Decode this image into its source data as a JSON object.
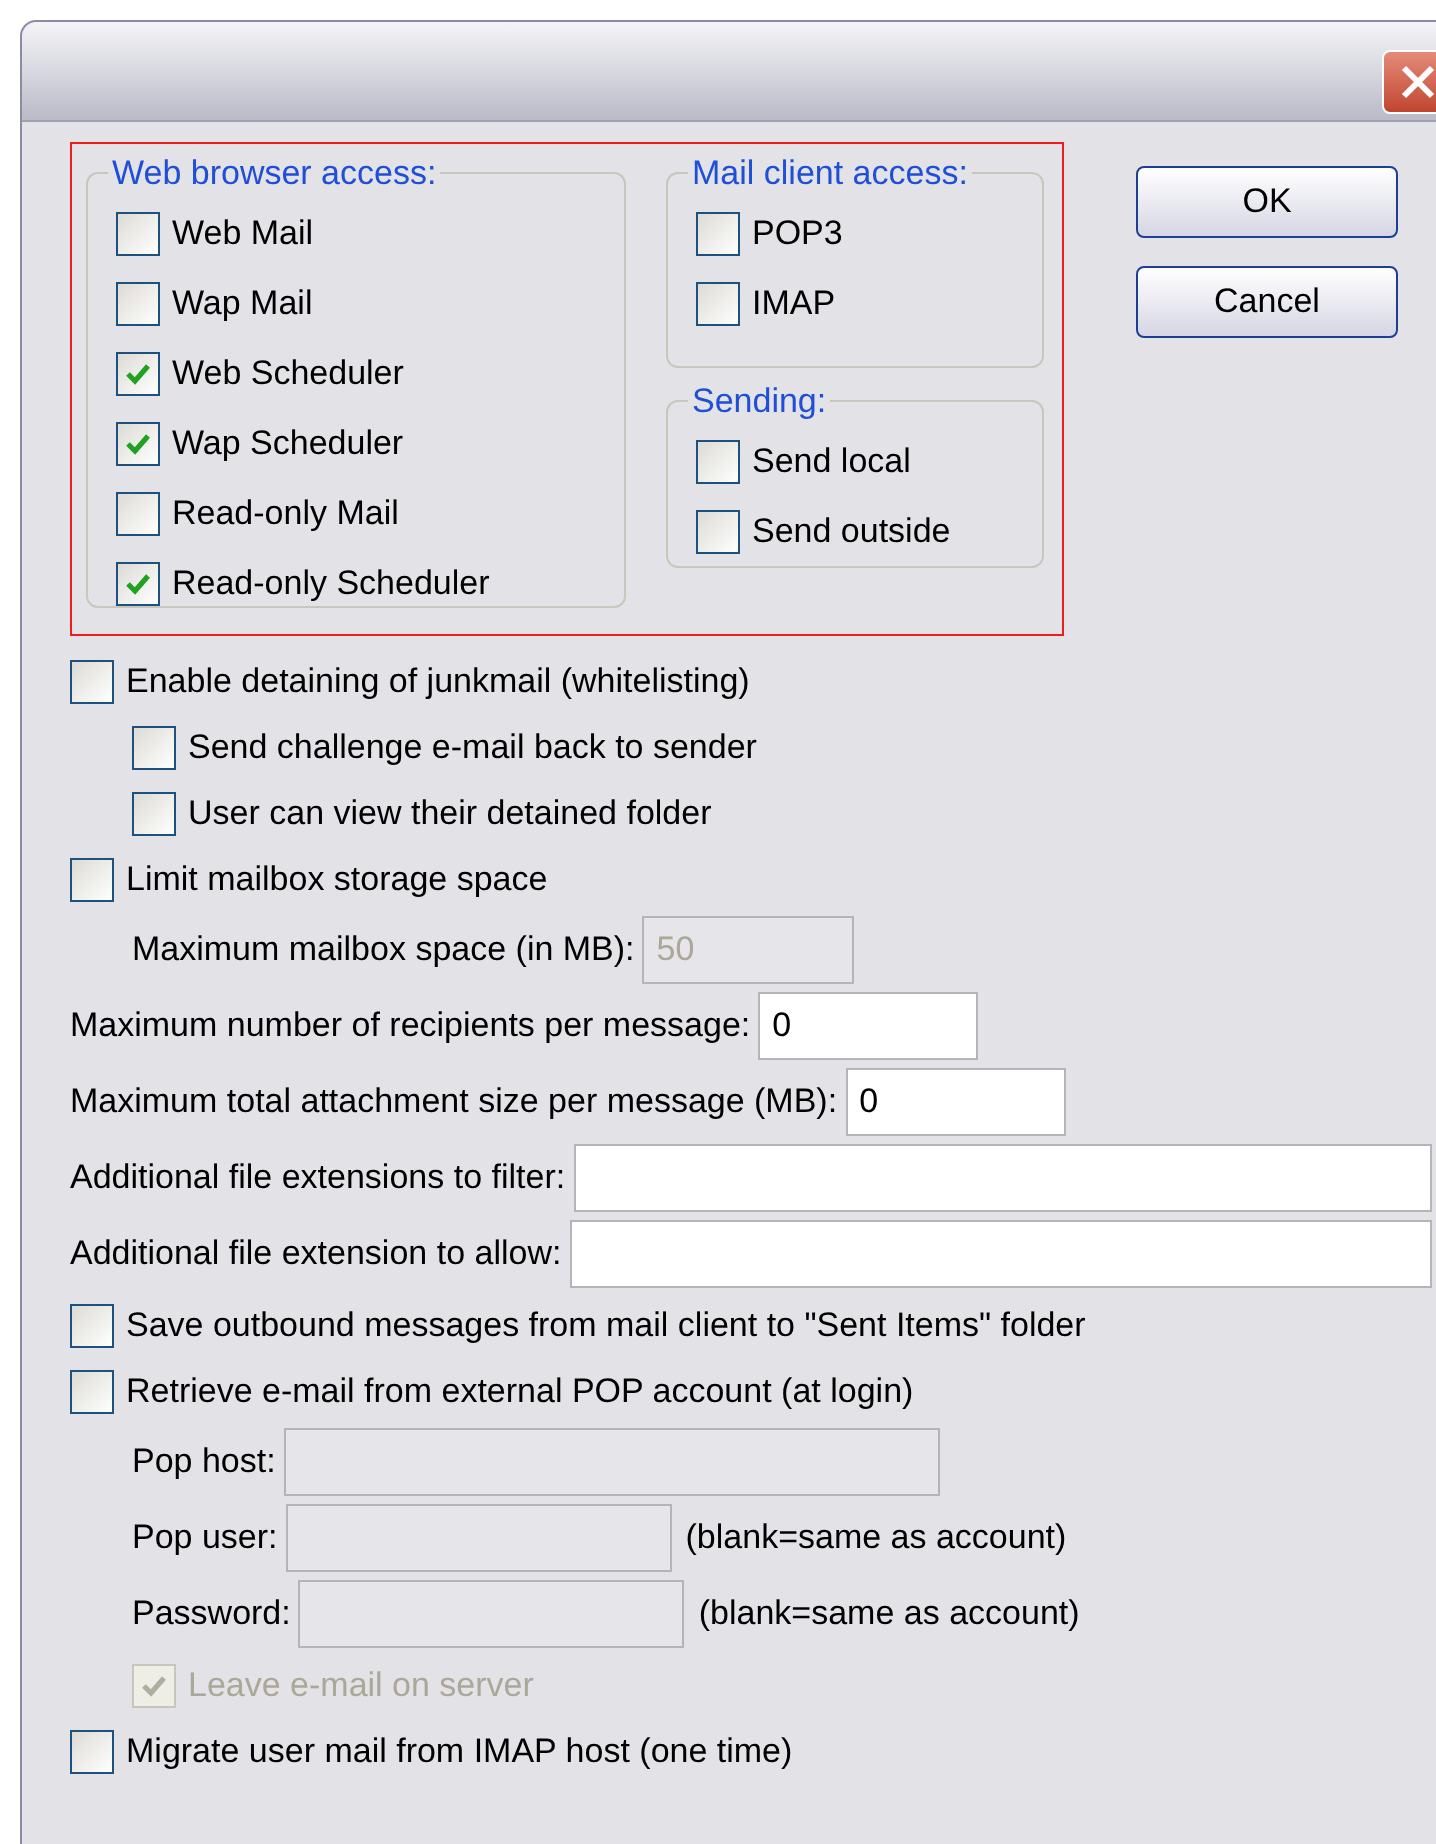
{
  "access": {
    "groups": [
      {
        "title": "Web browser access:",
        "items": [
          {
            "label": "Web Mail",
            "checked": false
          },
          {
            "label": "Wap Mail",
            "checked": false
          },
          {
            "label": "Web Scheduler",
            "checked": true
          },
          {
            "label": "Wap Scheduler",
            "checked": true
          },
          {
            "label": "Read-only Mail",
            "checked": false
          },
          {
            "label": "Read-only Scheduler",
            "checked": true
          }
        ]
      },
      {
        "title": "Mail client access:",
        "items": [
          {
            "label": "POP3",
            "checked": false
          },
          {
            "label": "IMAP",
            "checked": false
          }
        ]
      },
      {
        "title": "Sending:",
        "items": [
          {
            "label": "Send local",
            "checked": false
          },
          {
            "label": "Send outside",
            "checked": false
          }
        ]
      }
    ]
  },
  "buttons": [
    {
      "label": "OK"
    },
    {
      "label": "Cancel"
    }
  ],
  "options": [
    {
      "kind": "checkbox",
      "label": "Enable detaining of junkmail (whitelisting)",
      "checked": false,
      "children": [
        {
          "kind": "checkbox",
          "label": "Send challenge e-mail back to sender",
          "checked": false
        },
        {
          "kind": "checkbox",
          "label": "User can view their detained folder",
          "checked": false
        }
      ]
    },
    {
      "kind": "checkbox",
      "label": "Limit mailbox storage space",
      "checked": false,
      "children": [
        {
          "kind": "field",
          "label": "Maximum mailbox space (in MB):",
          "value": "50",
          "disabled": true
        }
      ]
    },
    {
      "kind": "field",
      "label": "Maximum number of recipients per message:",
      "value": "0"
    },
    {
      "kind": "field",
      "label": "Maximum total attachment size per message (MB):",
      "value": "0"
    },
    {
      "kind": "field",
      "label": "Additional file extensions to filter:"
    },
    {
      "kind": "field",
      "label": "Additional file extension to allow:"
    },
    {
      "kind": "checkbox",
      "label": "Save outbound messages from mail client to \"Sent Items\" folder",
      "checked": false
    },
    {
      "kind": "checkbox",
      "label": "Retrieve e-mail from external POP account (at login)",
      "checked": false,
      "children": [
        {
          "kind": "field",
          "label": "Pop host:",
          "disabled": true
        },
        {
          "kind": "field",
          "label": "Pop user:",
          "disabled": true,
          "note": "(blank=same as account)"
        },
        {
          "kind": "field",
          "label": "Password:",
          "disabled": true,
          "note": "(blank=same as account)"
        },
        {
          "kind": "checkbox",
          "label": "Leave e-mail on server",
          "checked": true,
          "disabled": true
        }
      ]
    },
    {
      "kind": "checkbox",
      "label": "Migrate user mail from IMAP host (one time)",
      "checked": false
    }
  ]
}
